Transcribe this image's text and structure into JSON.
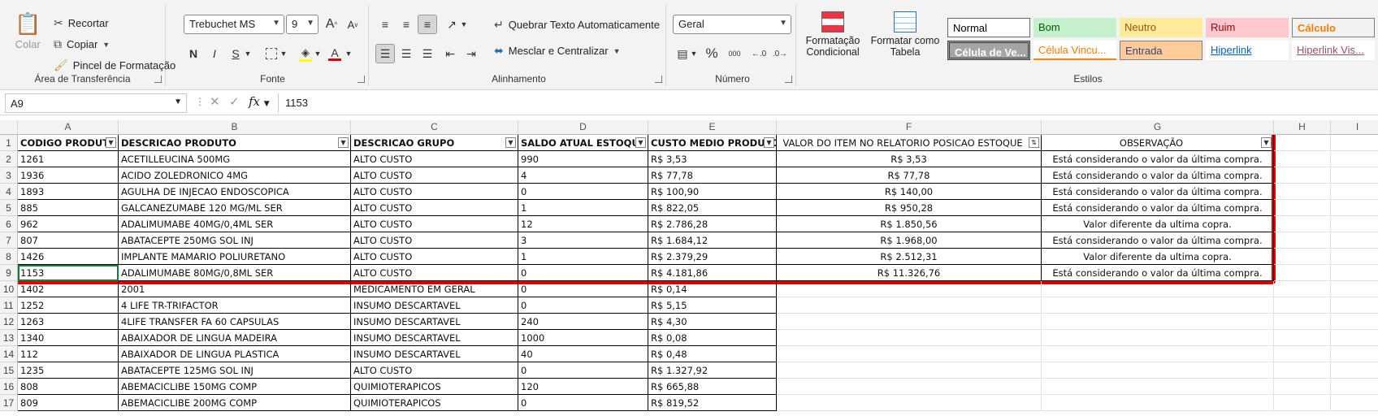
{
  "ribbon": {
    "clipboard": {
      "paste_label": "Colar",
      "cut_label": "Recortar",
      "copy_label": "Copiar",
      "format_painter_label": "Pincel de Formatação",
      "group_label": "Área de Transferência"
    },
    "font": {
      "font_name": "Trebuchet MS",
      "font_size": "9",
      "bold": "N",
      "italic": "I",
      "underline": "S",
      "font_color_letter": "A",
      "grow": "A",
      "shrink": "A",
      "group_label": "Fonte"
    },
    "alignment": {
      "wrap_text_label": "Quebrar Texto Automaticamente",
      "merge_center_label": "Mesclar e Centralizar",
      "group_label": "Alinhamento"
    },
    "number": {
      "format_value": "Geral",
      "percent": "%",
      "thousands": "000",
      "group_label": "Número"
    },
    "styles": {
      "conditional_label": "Formatação Condicional",
      "format_table_label": "Formatar como Tabela",
      "cell_styles": [
        {
          "label": "Normal",
          "bg": "#ffffff",
          "fg": "#000000"
        },
        {
          "label": "Bom",
          "bg": "#c6efce",
          "fg": "#006100"
        },
        {
          "label": "Neutro",
          "bg": "#ffeb9c",
          "fg": "#9c5700"
        },
        {
          "label": "Ruim",
          "bg": "#ffc7ce",
          "fg": "#9c0006"
        },
        {
          "label": "Cálculo",
          "bg": "#f2f2f2",
          "fg": "#fa7d00"
        },
        {
          "label": "Célula de Ve...",
          "bg": "#a5a5a5",
          "fg": "#ffffff"
        },
        {
          "label": "Célula Vincu...",
          "bg": "#ffffff",
          "fg": "#fa7d00"
        },
        {
          "label": "Entrada",
          "bg": "#ffcc99",
          "fg": "#3f3f76"
        },
        {
          "label": "Hiperlink",
          "bg": "#ffffff",
          "fg": "#0563c1"
        },
        {
          "label": "Hiperlink Vis...",
          "bg": "#ffffff",
          "fg": "#954f72"
        }
      ],
      "group_label": "Estilos"
    }
  },
  "formula_bar": {
    "name_box": "A9",
    "fx": "fx",
    "value": "1153"
  },
  "columns": [
    "A",
    "B",
    "C",
    "D",
    "E",
    "F",
    "G",
    "H",
    "I"
  ],
  "header_row": [
    "CODIGO PRODUTO",
    "DESCRICAO PRODUTO",
    "DESCRICAO GRUPO",
    "SALDO ATUAL ESTOQUE",
    "CUSTO MEDIO PRODUTO",
    "VALOR DO ITEM NO RELATORIO POSICAO ESTOQUE",
    "OBSERVAÇÃO"
  ],
  "rows": [
    {
      "n": "2",
      "cells": [
        "1261",
        "ACETILLEUCINA 500MG",
        "ALTO CUSTO",
        "990",
        "R$ 3,53",
        "R$ 3,53",
        "Está considerando o valor da última compra."
      ]
    },
    {
      "n": "3",
      "cells": [
        "1936",
        "ACIDO ZOLEDRONICO 4MG",
        "ALTO CUSTO",
        "4",
        "R$ 77,78",
        "R$ 77,78",
        "Está considerando o valor da última compra."
      ]
    },
    {
      "n": "4",
      "cells": [
        "1893",
        "AGULHA DE INJECAO ENDOSCOPICA",
        "ALTO CUSTO",
        "0",
        "R$ 100,90",
        "R$ 140,00",
        "Está considerando o valor da última compra."
      ]
    },
    {
      "n": "5",
      "cells": [
        "885",
        "GALCANEZUMABE 120 MG/ML SER",
        "ALTO CUSTO",
        "1",
        "R$ 822,05",
        "R$ 950,28",
        "Está considerando o valor da última compra."
      ]
    },
    {
      "n": "6",
      "cells": [
        "962",
        "ADALIMUMABE 40MG/0,4ML SER",
        "ALTO CUSTO",
        "12",
        "R$ 2.786,28",
        "R$ 1.850,56",
        "Valor diferente da ultima copra."
      ]
    },
    {
      "n": "7",
      "cells": [
        "807",
        "ABATACEPTE 250MG SOL INJ",
        "ALTO CUSTO",
        "3",
        "R$ 1.684,12",
        "R$ 1.968,00",
        "Está considerando o valor da última compra."
      ]
    },
    {
      "n": "8",
      "cells": [
        "1426",
        "IMPLANTE MAMARIO POLIURETANO",
        "ALTO CUSTO",
        "1",
        "R$ 2.379,29",
        "R$ 2.512,31",
        "Valor diferente da ultima copra."
      ]
    },
    {
      "n": "9",
      "cells": [
        "1153",
        "ADALIMUMABE 80MG/0,8ML SER",
        "ALTO CUSTO",
        "0",
        "R$ 4.181,86",
        "R$ 11.326,76",
        "Está considerando o valor da última compra."
      ]
    },
    {
      "n": "10",
      "cells": [
        "1402",
        "2001",
        "MEDICAMENTO EM GERAL",
        "0",
        "R$ 0,14",
        "",
        ""
      ]
    },
    {
      "n": "11",
      "cells": [
        "1252",
        "4 LIFE TR-TRIFACTOR",
        "INSUMO DESCARTAVEL",
        "0",
        "R$ 5,15",
        "",
        ""
      ]
    },
    {
      "n": "12",
      "cells": [
        "1263",
        "4LIFE TRANSFER FA 60 CAPSULAS",
        "INSUMO DESCARTAVEL",
        "240",
        "R$ 4,30",
        "",
        ""
      ]
    },
    {
      "n": "13",
      "cells": [
        "1340",
        "ABAIXADOR DE LINGUA MADEIRA",
        "INSUMO DESCARTAVEL",
        "1000",
        "R$ 0,08",
        "",
        ""
      ]
    },
    {
      "n": "14",
      "cells": [
        "112",
        "ABAIXADOR DE LINGUA PLASTICA",
        "INSUMO DESCARTAVEL",
        "40",
        "R$ 0,48",
        "",
        ""
      ]
    },
    {
      "n": "15",
      "cells": [
        "1235",
        "ABATACEPTE 125MG SOL INJ",
        "ALTO CUSTO",
        "0",
        "R$ 1.327,92",
        "",
        ""
      ]
    },
    {
      "n": "16",
      "cells": [
        "808",
        "ABEMACICLIBE 150MG COMP",
        "QUIMIOTERAPICOS",
        "120",
        "R$ 665,88",
        "",
        ""
      ]
    },
    {
      "n": "17",
      "cells": [
        "809",
        "ABEMACICLIBE 200MG COMP",
        "QUIMIOTERAPICOS",
        "0",
        "R$ 819,52",
        "",
        ""
      ]
    }
  ]
}
